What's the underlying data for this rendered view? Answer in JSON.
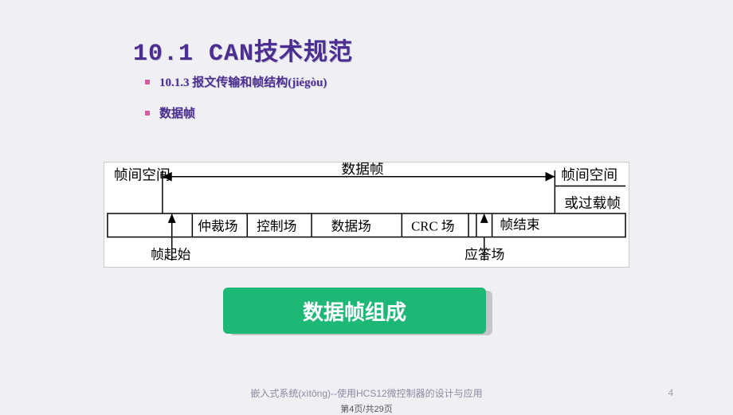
{
  "title": "10.1 CAN技术规范",
  "bullets": [
    "10.1.3 报文传输和帧结构(jiégòu)",
    "数据帧"
  ],
  "diagram": {
    "top_left": "帧间空间",
    "top_center": "数据帧",
    "top_right": "帧间空间",
    "right_second": "或过载帧",
    "fields": {
      "start": "帧起始",
      "arbitration": "仲裁场",
      "control": "控制场",
      "data": "数据场",
      "crc": "CRC 场",
      "ack": "应答场",
      "end": "帧结束"
    }
  },
  "green_box": "数据帧组成",
  "footer": "嵌入式系统(xìtǒng)--使用HCS12微控制器的设计与应用",
  "page_number": "4",
  "page_indicator": "第4页/共29页"
}
